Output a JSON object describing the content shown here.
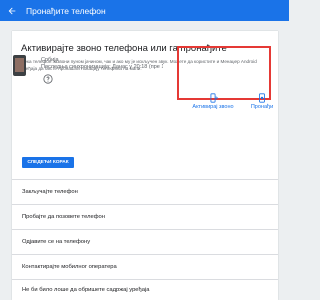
{
  "header": {
    "title": "Пронађите телефон",
    "back_icon": "arrow-back-icon"
  },
  "main": {
    "heading": "Активирајте звоно телефона или га пронађите",
    "description": "Нека телефон зазвони пуном јачином, чак и ако му је искључен звук. Можете да користите и Менаџер Android уређаја да бисте пронашли локацију телефона на мапи:",
    "device": {
      "name": "Србија",
      "last_sync": "Последња синхронизација: Данас у 20:18 (пре 1 сата)"
    },
    "actions": [
      {
        "label": "Активирај звоно",
        "icon": "phone-ring-icon"
      },
      {
        "label": "Пронађи",
        "icon": "find-device-icon"
      }
    ],
    "next_button": "СЛЕДЕЋИ КОРАК"
  },
  "options": [
    "Закључајте телефон",
    "Пробајте да позовете телефон",
    "Одјавите се на телефону",
    "Контактирајте мобилног оператера",
    "Не би било лоше да обришете садржај уређаја"
  ],
  "colors": {
    "accent": "#1a73e8",
    "highlight": "#e53935",
    "background": "#eceff1"
  }
}
